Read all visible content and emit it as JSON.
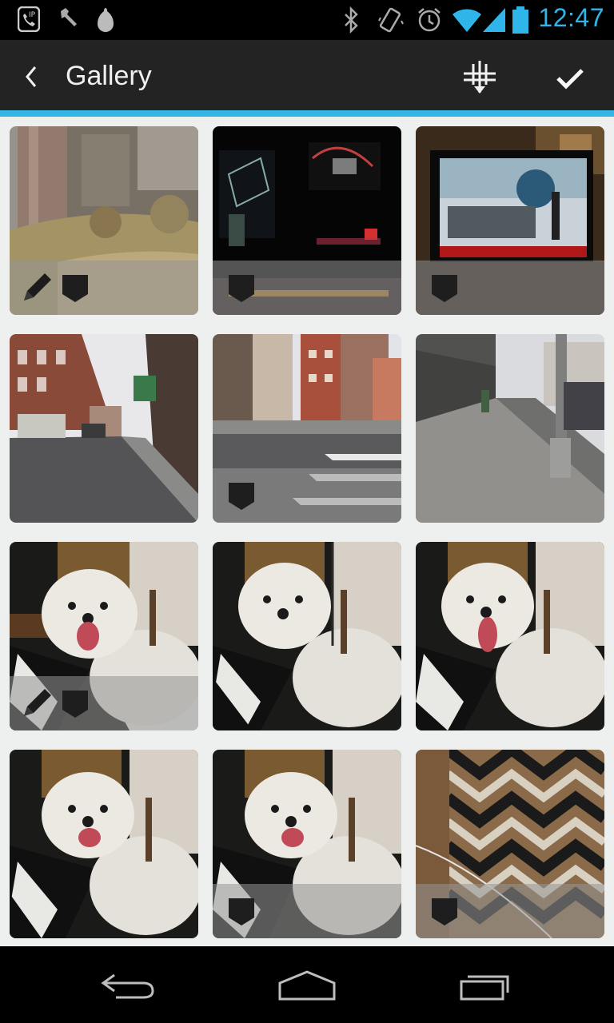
{
  "status_bar": {
    "time": "12:47",
    "icons": [
      "voip-icon",
      "wrench-icon",
      "pear-icon",
      "bluetooth-icon",
      "vibrate-icon",
      "alarm-icon",
      "wifi-icon",
      "signal-icon",
      "battery-icon"
    ],
    "accent_color": "#2fb5ea"
  },
  "action_bar": {
    "title": "Gallery",
    "back_icon": "chevron-left-icon",
    "sort_icon": "sort-icon",
    "done_icon": "checkmark-icon",
    "accent_color": "#33b5e5"
  },
  "gallery": {
    "items": [
      {
        "subject": "street-trees",
        "edited": true,
        "tagged": true
      },
      {
        "subject": "dark-lights",
        "edited": false,
        "tagged": true
      },
      {
        "subject": "tv-screen",
        "edited": false,
        "tagged": true
      },
      {
        "subject": "city-street",
        "edited": false,
        "tagged": false
      },
      {
        "subject": "crosswalk",
        "edited": false,
        "tagged": true
      },
      {
        "subject": "sidewalk",
        "edited": false,
        "tagged": false
      },
      {
        "subject": "dog",
        "edited": true,
        "tagged": true
      },
      {
        "subject": "dog",
        "edited": false,
        "tagged": false
      },
      {
        "subject": "dog",
        "edited": false,
        "tagged": false
      },
      {
        "subject": "dog",
        "edited": false,
        "tagged": false
      },
      {
        "subject": "dog",
        "edited": false,
        "tagged": true
      },
      {
        "subject": "zigzag-rug",
        "edited": false,
        "tagged": true
      }
    ]
  },
  "nav_bar": {
    "icons": [
      "back-nav-icon",
      "home-nav-icon",
      "recent-apps-icon"
    ]
  }
}
